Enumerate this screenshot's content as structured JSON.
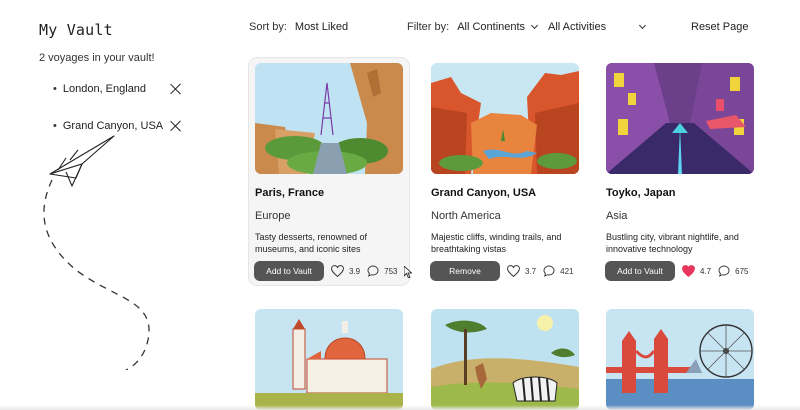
{
  "sidebar": {
    "title": "My Vault",
    "count_text": "2 voyages in your vault!",
    "items": [
      {
        "label": "London, England"
      },
      {
        "label": "Grand Canyon, USA"
      }
    ]
  },
  "toolbar": {
    "sort_label": "Sort by:",
    "sort_value": "Most Liked",
    "filter_label": "Filter by:",
    "continent_value": "All Continents",
    "activity_value": "All Activities",
    "reset_label": "Reset Page"
  },
  "cards": [
    {
      "title": "Paris, France",
      "region": "Europe",
      "description": "Tasty desserts, renowned of museums, and iconic sites",
      "button": "Add to Vault",
      "rating": "3.9",
      "comments": "753",
      "liked": false
    },
    {
      "title": "Grand Canyon, USA",
      "region": "North America",
      "description": "Majestic cliffs, winding trails, and breathtaking vistas",
      "button": "Remove",
      "rating": "3.7",
      "comments": "421",
      "liked": false
    },
    {
      "title": "Toyko, Japan",
      "region": "Asia",
      "description": "Bustling city, vibrant nightlife, and innovative technology",
      "button": "Add to Vault",
      "rating": "4.7",
      "comments": "675",
      "liked": true
    }
  ],
  "colors": {
    "button": "#555555",
    "liked_heart": "#e8365d",
    "card_hover_bg": "#f5f5f5"
  },
  "icons": {
    "remove": "close-icon",
    "like": "heart-icon",
    "comment": "comment-icon",
    "dropdown": "chevron-down-icon",
    "doodle": "paper-plane-icon"
  }
}
